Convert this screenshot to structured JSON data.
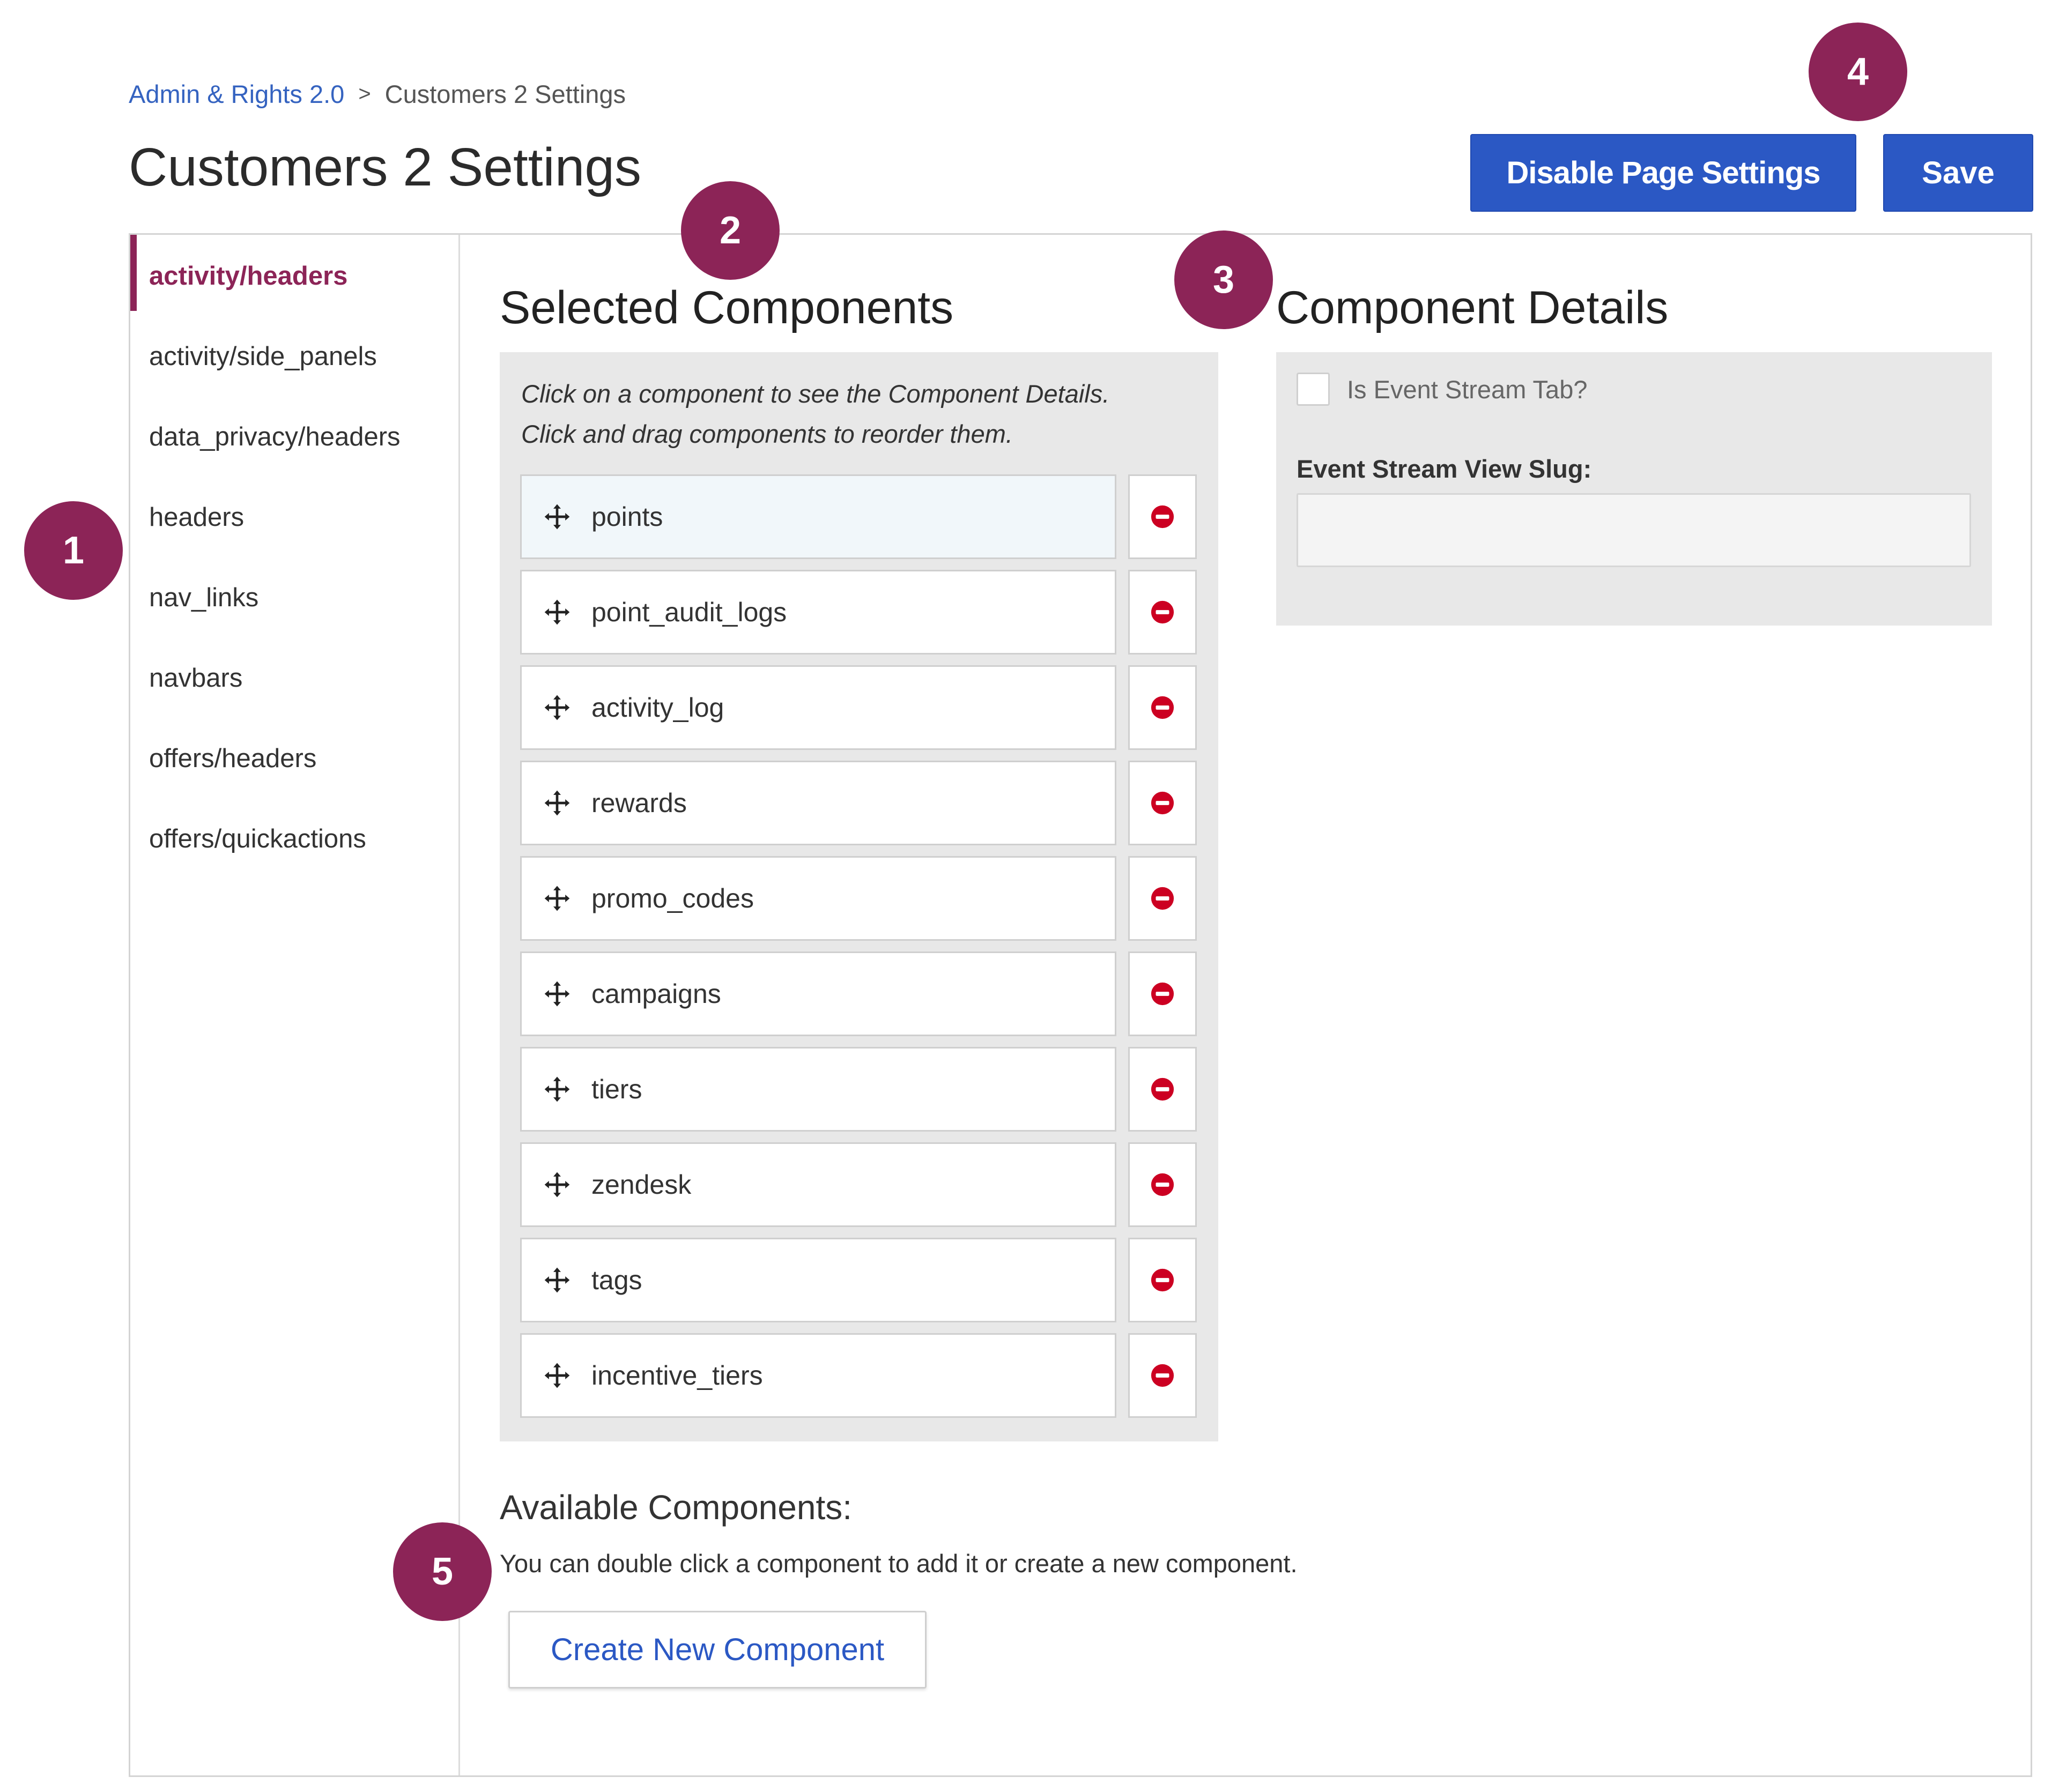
{
  "breadcrumb": {
    "parent": "Admin & Rights 2.0",
    "separator": ">",
    "current": "Customers 2 Settings"
  },
  "page_title": "Customers 2 Settings",
  "actions": {
    "disable_label": "Disable Page Settings",
    "save_label": "Save"
  },
  "sidebar": {
    "items": [
      {
        "label": "activity/headers",
        "active": true
      },
      {
        "label": "activity/side_panels"
      },
      {
        "label": "data_privacy/headers"
      },
      {
        "label": "headers"
      },
      {
        "label": "nav_links"
      },
      {
        "label": "navbars"
      },
      {
        "label": "offers/headers"
      },
      {
        "label": "offers/quickactions"
      }
    ]
  },
  "selected": {
    "title": "Selected Components",
    "hint1": "Click on a component to see the Component Details.",
    "hint2": "Click and drag components to reorder them.",
    "components": [
      "points",
      "point_audit_logs",
      "activity_log",
      "rewards",
      "promo_codes",
      "campaigns",
      "tiers",
      "zendesk",
      "tags",
      "incentive_tiers"
    ]
  },
  "details": {
    "title": "Component Details",
    "checkbox_label": "Is Event Stream Tab?",
    "slug_label": "Event Stream View Slug:",
    "slug_value": ""
  },
  "available": {
    "title": "Available Components:",
    "description": "You can double click a component to add it or create a new component.",
    "create_label": "Create New Component"
  },
  "callouts": [
    "1",
    "2",
    "3",
    "4",
    "5"
  ],
  "colors": {
    "accent": "#8c2457",
    "primary": "#2b58c4",
    "remove": "#cc0022"
  }
}
